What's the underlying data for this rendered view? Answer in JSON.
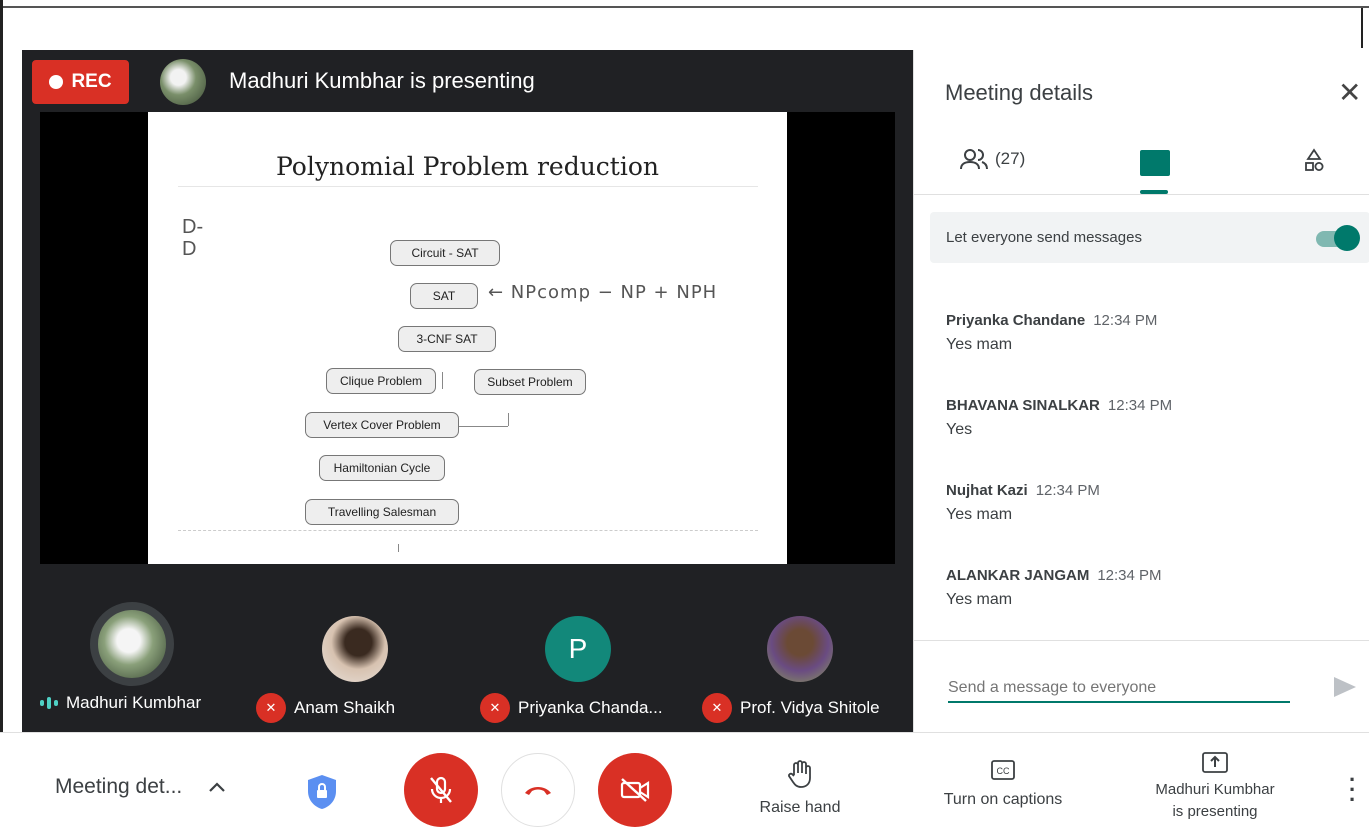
{
  "stage": {
    "rec_label": "REC",
    "presenter_status": "Madhuri Kumbhar is presenting"
  },
  "slide": {
    "title": "Polynomial Problem reduction",
    "nodes": {
      "circuit_sat": "Circuit - SAT",
      "sat": "SAT",
      "cnf_sat": "3-CNF SAT",
      "clique": "Clique Problem",
      "subset": "Subset Problem",
      "vertex_cover": "Vertex Cover Problem",
      "hamiltonian": "Hamiltonian Cycle",
      "travelling": "Travelling Salesman"
    },
    "handwriting": "← NPcomp − NP + NPH",
    "scribble": "D-\nD"
  },
  "participants": [
    {
      "name": "Madhuri Kumbhar",
      "avatar": "flower-photo",
      "state": "speaking"
    },
    {
      "name": "Anam Shaikh",
      "avatar": "photo",
      "state": "muted"
    },
    {
      "name": "Priyanka Chanda...",
      "avatar_letter": "P",
      "state": "muted"
    },
    {
      "name": "Prof. Vidya Shitole",
      "avatar": "photo",
      "state": "muted"
    }
  ],
  "panel": {
    "title": "Meeting details",
    "people_count": "(27)",
    "toggle_label": "Let everyone send messages",
    "toggle_on": true,
    "messages": [
      {
        "sender": "Priyanka Chandane",
        "time": "12:34 PM",
        "text": "Yes mam"
      },
      {
        "sender": "BHAVANA SINALKAR",
        "time": "12:34 PM",
        "text": "Yes"
      },
      {
        "sender": "Nujhat Kazi",
        "time": "12:34 PM",
        "text": "Yes mam"
      },
      {
        "sender": "ALANKAR JANGAM",
        "time": "12:34 PM",
        "text": "Yes mam"
      }
    ],
    "input_placeholder": "Send a message to everyone"
  },
  "controls": {
    "meeting_details": "Meeting det...",
    "raise_hand": "Raise hand",
    "captions": "Turn on captions",
    "presenting_line1": "Madhuri Kumbhar",
    "presenting_line2": "is presenting"
  },
  "colors": {
    "accent": "#00796b",
    "danger": "#d93025",
    "stage_bg": "#202124"
  }
}
